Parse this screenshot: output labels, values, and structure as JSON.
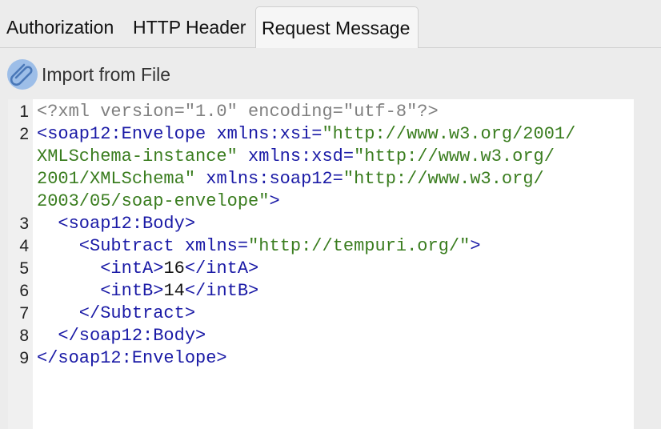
{
  "tabs": [
    {
      "label": "Authorization",
      "active": false
    },
    {
      "label": "HTTP Header",
      "active": false
    },
    {
      "label": "Request Message",
      "active": true
    }
  ],
  "toolbar": {
    "import_label": "Import from File",
    "import_icon": "paperclip-icon"
  },
  "editor": {
    "line_numbers": [
      "1",
      "2",
      "3",
      "4",
      "5",
      "6",
      "7",
      "8",
      "9"
    ],
    "lines": [
      [
        {
          "t": "decl",
          "v": "<?xml version=\"1.0\" encoding=\"utf-8\"?>"
        }
      ],
      [
        {
          "t": "tag",
          "v": "<soap12:Envelope "
        },
        {
          "t": "attr",
          "v": "xmlns:xsi="
        },
        {
          "t": "str",
          "v": "\"http://www.w3.org/2001/"
        }
      ],
      [
        {
          "t": "str",
          "v": "XMLSchema-instance\""
        },
        {
          "t": "attr",
          "v": " xmlns:xsd="
        },
        {
          "t": "str",
          "v": "\"http://www.w3.org/"
        }
      ],
      [
        {
          "t": "str",
          "v": "2001/XMLSchema\""
        },
        {
          "t": "attr",
          "v": " xmlns:soap12="
        },
        {
          "t": "str",
          "v": "\"http://www.w3.org/"
        }
      ],
      [
        {
          "t": "str",
          "v": "2003/05/soap-envelope\""
        },
        {
          "t": "tag",
          "v": ">"
        }
      ],
      [
        {
          "t": "tag",
          "v": "  <soap12:Body>"
        }
      ],
      [
        {
          "t": "tag",
          "v": "    <Subtract "
        },
        {
          "t": "attr",
          "v": "xmlns="
        },
        {
          "t": "str",
          "v": "\"http://tempuri.org/\""
        },
        {
          "t": "tag",
          "v": ">"
        }
      ],
      [
        {
          "t": "tag",
          "v": "      <intA>"
        },
        {
          "t": "txt",
          "v": "16"
        },
        {
          "t": "tag",
          "v": "</intA>"
        }
      ],
      [
        {
          "t": "tag",
          "v": "      <intB>"
        },
        {
          "t": "txt",
          "v": "14"
        },
        {
          "t": "tag",
          "v": "</intB>"
        }
      ],
      [
        {
          "t": "tag",
          "v": "    </Subtract>"
        }
      ],
      [
        {
          "t": "tag",
          "v": "  </soap12:Body>"
        }
      ],
      [
        {
          "t": "tag",
          "v": "</soap12:Envelope>"
        }
      ]
    ]
  },
  "colors": {
    "tag": "#1a1aa6",
    "string": "#3a7d1f",
    "declaration": "#808080"
  }
}
